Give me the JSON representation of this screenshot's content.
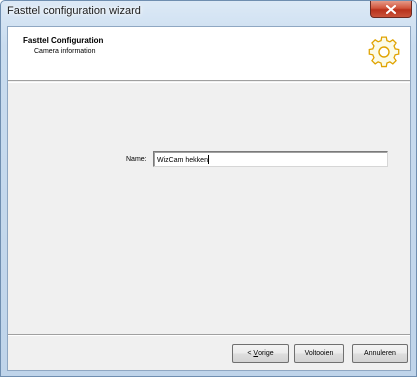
{
  "window": {
    "title": "Fasttel configuration wizard",
    "close_glyph": "x"
  },
  "header": {
    "title": "Fasttel Configuration",
    "subtitle": "Camera information",
    "icon": "gear-icon",
    "icon_color": "#f1b500"
  },
  "form": {
    "name_label": "Name:",
    "name_value": "WizCam hekken"
  },
  "buttons": {
    "back_prefix": "< ",
    "back_mnemonic": "V",
    "back_rest": "orige",
    "finish_label": "Voltooien",
    "cancel_label": "Annuleren"
  },
  "colors": {
    "close_button": "#c8472d",
    "client_background": "#f0f0f0"
  }
}
